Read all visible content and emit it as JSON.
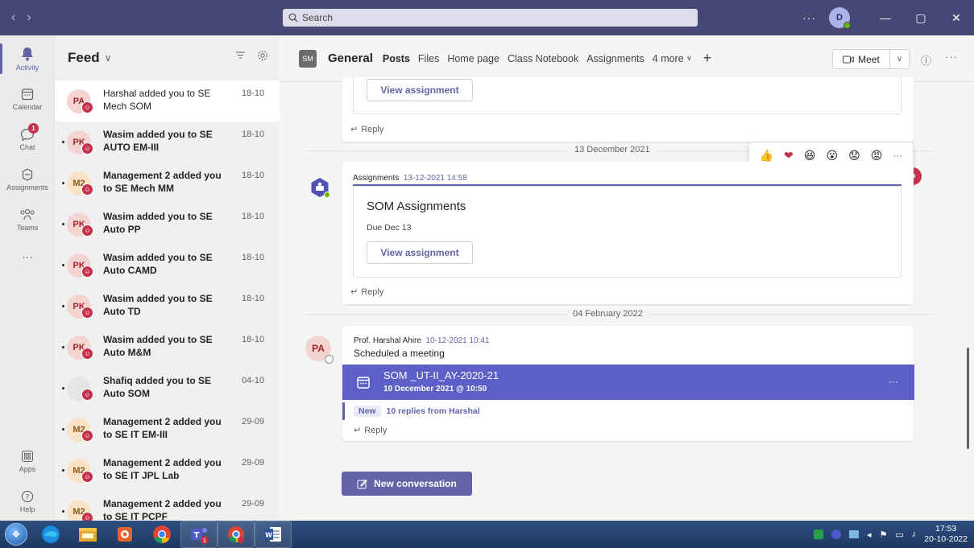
{
  "titlebar": {
    "search_placeholder": "Search",
    "more": "···",
    "avatar_initials": "D",
    "colors": {
      "bar": "#464775"
    }
  },
  "rail": {
    "items": [
      {
        "label": "Activity",
        "icon": "bell-icon"
      },
      {
        "label": "Calendar",
        "icon": "calendar-icon"
      },
      {
        "label": "Chat",
        "icon": "chat-icon",
        "badge": "1"
      },
      {
        "label": "Assignments",
        "icon": "assignments-icon"
      },
      {
        "label": "Teams",
        "icon": "teams-icon"
      },
      {
        "label": "···",
        "icon": "more-icon"
      }
    ],
    "bottom": [
      {
        "label": "Apps",
        "icon": "apps-icon"
      },
      {
        "label": "Help",
        "icon": "help-icon"
      }
    ]
  },
  "feed": {
    "title": "Feed",
    "items": [
      {
        "initials": "PA",
        "text": "Harshal added you to SE Mech SOM",
        "time": "18-10",
        "unread": false
      },
      {
        "initials": "PK",
        "text": "Wasim added you to SE AUTO EM-III",
        "time": "18-10",
        "unread": true
      },
      {
        "initials": "M2",
        "text": "Management 2 added you to SE Mech MM",
        "time": "18-10",
        "unread": true
      },
      {
        "initials": "PK",
        "text": "Wasim added you to SE Auto PP",
        "time": "18-10",
        "unread": true
      },
      {
        "initials": "PK",
        "text": "Wasim added you to SE Auto CAMD",
        "time": "18-10",
        "unread": true
      },
      {
        "initials": "PK",
        "text": "Wasim added you to SE Auto TD",
        "time": "18-10",
        "unread": true
      },
      {
        "initials": "PK",
        "text": "Wasim added you to SE Auto M&M",
        "time": "18-10",
        "unread": true
      },
      {
        "initials": "",
        "text": "Shafiq added you to SE Auto SOM",
        "time": "04-10",
        "unread": true
      },
      {
        "initials": "M2",
        "text": "Management 2 added you to SE IT EM-III",
        "time": "29-09",
        "unread": true
      },
      {
        "initials": "M2",
        "text": "Management 2 added you to SE IT JPL Lab",
        "time": "29-09",
        "unread": true
      },
      {
        "initials": "M2",
        "text": "Management 2 added you to SE IT PCPF",
        "time": "29-09",
        "unread": true
      }
    ]
  },
  "header": {
    "team_initials": "SM",
    "channel": "General",
    "tabs": [
      "Posts",
      "Files",
      "Home page",
      "Class Notebook",
      "Assignments",
      "4 more"
    ],
    "meet": "Meet"
  },
  "posts": {
    "top_view_btn": "View assignment",
    "reply": "Reply",
    "date1": "13 December 2021",
    "assign_author": "Assignments",
    "assign_time": "13-12-2021 14:58",
    "assign_title": "SOM Assignments",
    "assign_due": "Due Dec 13",
    "assign_view_btn": "View assignment",
    "date2": "04 February 2022",
    "meet_author": "Prof. Harshal Ahire",
    "meet_time": "10-12-2021 10:41",
    "meet_subtitle": "Scheduled a meeting",
    "meet_av": "PA",
    "meeting_title": "SOM _UT-II_AY-2020-21",
    "meeting_when": "10 December 2021 @ 10:50",
    "meeting_more": "···",
    "new_tag": "New",
    "new_replies": "10 replies from Harshal",
    "new_conversation": "New conversation"
  },
  "reactions": [
    "👍",
    "❤",
    "😆",
    "😮",
    "😟",
    "😡",
    "···"
  ],
  "taskbar": {
    "time": "17:53",
    "date": "20-10-2022"
  }
}
